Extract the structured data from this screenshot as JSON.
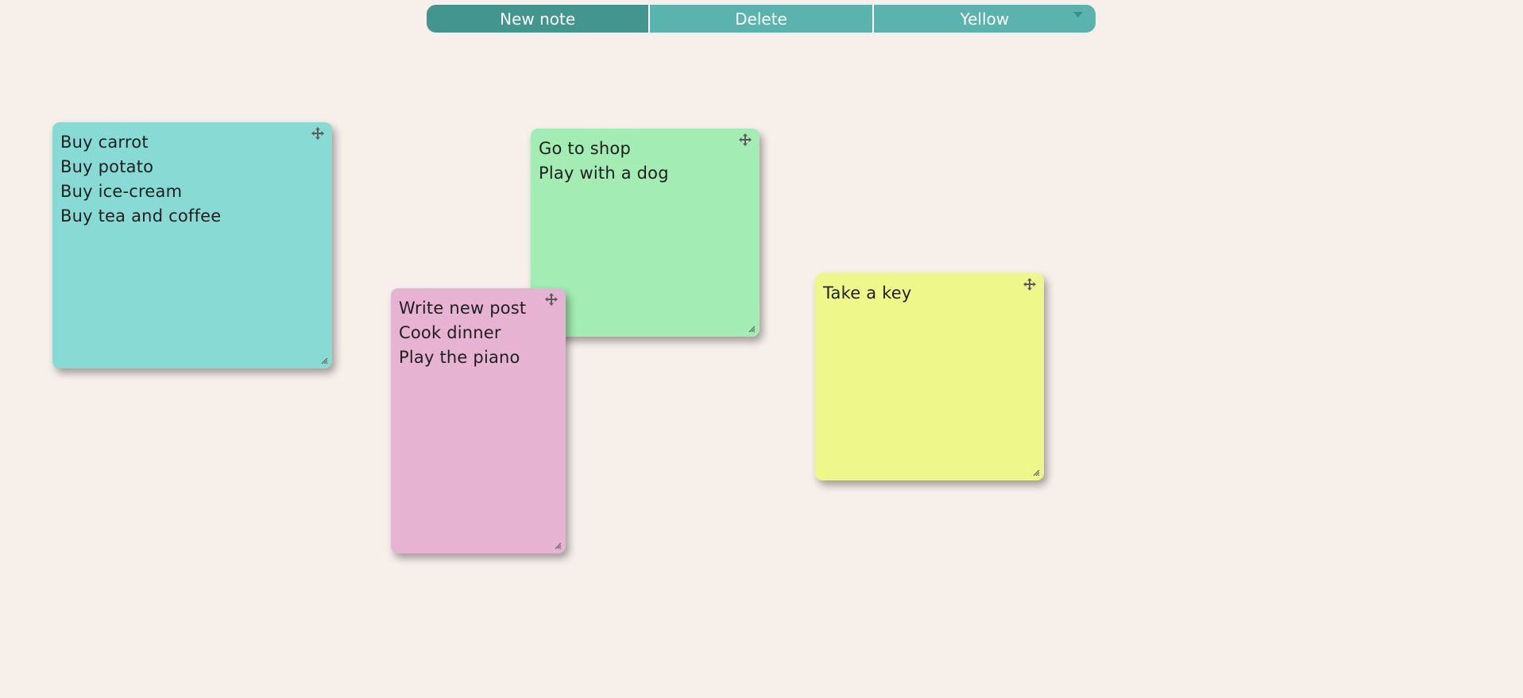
{
  "toolbar": {
    "new_note_label": "New note",
    "delete_label": "Delete",
    "color_select_label": "Yellow"
  },
  "notes": [
    {
      "color": "#88dbd4",
      "lines": [
        "Buy carrot",
        "Buy potato",
        "Buy ice-cream",
        "Buy tea and coffee"
      ]
    },
    {
      "color": "#a3ecb3",
      "lines": [
        "Go to shop",
        "Play with a dog"
      ]
    },
    {
      "color": "#e7b3d3",
      "lines": [
        "Write new post",
        "Cook dinner",
        "Play the piano"
      ]
    },
    {
      "color": "#eef78a",
      "lines": [
        "Take a key"
      ]
    }
  ],
  "colors": {
    "background": "#f7efea",
    "toolbar": "#5ab3ae",
    "toolbar_active": "#43968f"
  },
  "icons": {
    "move": "move-arrows-icon",
    "resize": "resize-grip-icon",
    "dropdown": "chevron-down-icon"
  }
}
